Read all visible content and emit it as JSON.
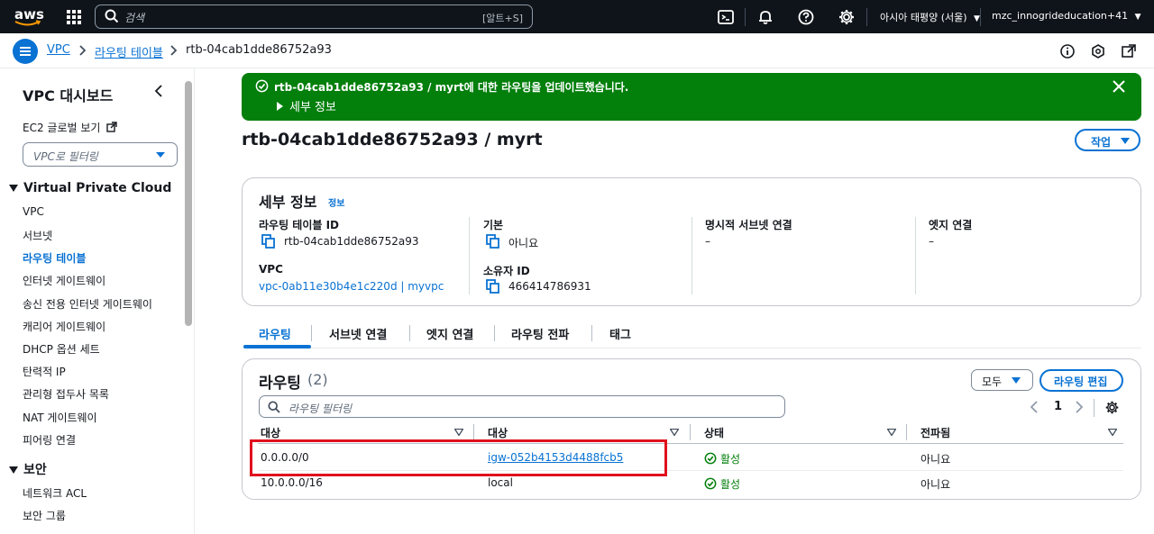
{
  "topbar": {
    "logo": "aws",
    "search_placeholder": "검색",
    "search_shortcut": "[알트+S]",
    "region": "아시아 태평양 (서울)",
    "account": "mzc_innogrideducation+41",
    "icons": [
      "grid-icon",
      "cloudshell-icon",
      "bell-icon",
      "help-icon",
      "gear-icon"
    ]
  },
  "breadcrumb": {
    "items": [
      "VPC",
      "라우팅 테이블",
      "rtb-04cab1dde86752a93"
    ]
  },
  "sidebar": {
    "title": "VPC 대시보드",
    "ec2_link": "EC2 글로벌 보기",
    "filter_placeholder": "VPC로 필터링",
    "section_vpc": "Virtual Private Cloud",
    "vpc_items": [
      "VPC",
      "서브넷",
      "라우팅 테이블",
      "인터넷 게이트웨이",
      "송신 전용 인터넷 게이트웨이",
      "캐리어 게이트웨이",
      "DHCP 옵션 세트",
      "탄력적 IP",
      "관리형 접두사 목록",
      "NAT 게이트웨이",
      "피어링 연결"
    ],
    "active_item": "라우팅 테이블",
    "section_security": "보안",
    "security_items": [
      "네트워크 ACL",
      "보안 그룹"
    ]
  },
  "flash": {
    "message": "rtb-04cab1dde86752a93 / myrt에 대한 라우팅을 업데이트했습니다.",
    "details": "세부 정보",
    "color": "#037f0c"
  },
  "page": {
    "title": "rtb-04cab1dde86752a93 / myrt",
    "actions_button": "작업"
  },
  "details": {
    "header": "세부 정보",
    "info": "정보",
    "route_table_id_label": "라우팅 테이블 ID",
    "route_table_id": "rtb-04cab1dde86752a93",
    "vpc_label": "VPC",
    "vpc_value": "vpc-0ab11e30b4e1c220d | myvpc",
    "main_label": "기본",
    "main_value": "아니요",
    "owner_label": "소유자 ID",
    "owner_value": "466414786931",
    "explicit_subnet_label": "명시적 서브넷 연결",
    "explicit_subnet_value": "–",
    "edge_label": "엣지 연결",
    "edge_value": "–"
  },
  "tabs": [
    "라우팅",
    "서브넷 연결",
    "엣지 연결",
    "라우팅 전파",
    "태그"
  ],
  "routes": {
    "header": "라우팅",
    "count": "(2)",
    "filter_dropdown": "모두",
    "edit_button": "라우팅 편집",
    "filter_placeholder": "라우팅 필터링",
    "page_number": "1",
    "columns": [
      "대상",
      "대상",
      "상태",
      "전파됨"
    ],
    "rows": [
      {
        "destination": "0.0.0.0/0",
        "target": "igw-052b4153d4488fcb5",
        "status": "활성",
        "propagated": "아니요"
      },
      {
        "destination": "10.0.0.0/16",
        "target": "local",
        "status": "활성",
        "propagated": "아니요"
      }
    ]
  }
}
